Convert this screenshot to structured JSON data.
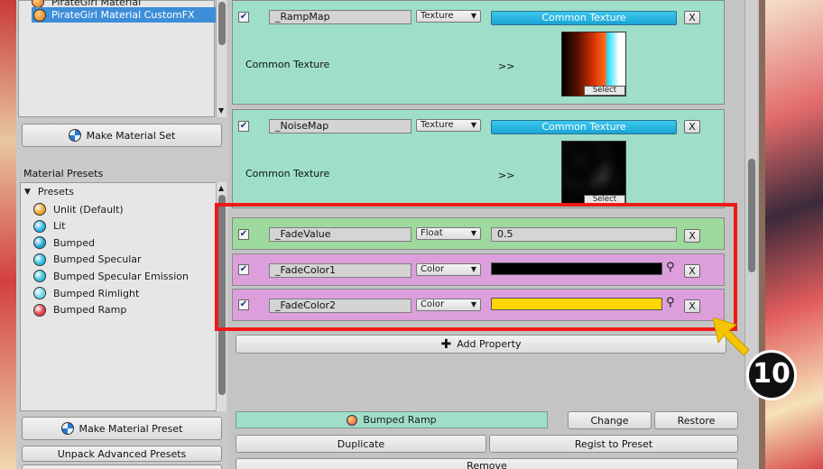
{
  "left_panel": {
    "material_list": [
      {
        "label": "PirateGirl Material",
        "selected": false
      },
      {
        "label": "PirateGirl Material CustomFX",
        "selected": true
      }
    ],
    "make_material_set": "Make Material Set",
    "presets_section_title": "Material Presets",
    "presets_root": "Presets",
    "presets": [
      {
        "label": "Unlit (Default)",
        "color": "#f5a623"
      },
      {
        "label": "Lit",
        "color": "#29b6e8"
      },
      {
        "label": "Bumped",
        "color": "#1fa8d8"
      },
      {
        "label": "Bumped Specular",
        "color": "#2ec0e0"
      },
      {
        "label": "Bumped Specular Emission",
        "color": "#35c4d8"
      },
      {
        "label": "Bumped Rimlight",
        "color": "#6ad8e8"
      },
      {
        "label": "Bumped Ramp",
        "color": "#e84040"
      }
    ],
    "make_material_preset": "Make Material Preset",
    "unpack_advanced_presets": "Unpack Advanced Presets"
  },
  "properties": [
    {
      "name": "_RampMap",
      "type": "Texture",
      "value": "Common Texture",
      "sub_label": "Common Texture",
      "arrow": ">>",
      "select": "Select",
      "enabled": true
    },
    {
      "name": "_NoiseMap",
      "type": "Texture",
      "value": "Common Texture",
      "sub_label": "Common Texture",
      "arrow": ">>",
      "select": "Select",
      "enabled": true
    },
    {
      "name": "_FadeValue",
      "type": "Float",
      "value": "0.5",
      "enabled": true
    },
    {
      "name": "_FadeColor1",
      "type": "Color",
      "color_value": "#000000",
      "enabled": true
    },
    {
      "name": "_FadeColor2",
      "type": "Color",
      "color_value": "#ffd400",
      "enabled": true
    }
  ],
  "remove_symbol": "X",
  "add_property": "Add Property",
  "bottom": {
    "current_preset": "Bumped Ramp",
    "change": "Change",
    "restore": "Restore",
    "duplicate": "Duplicate",
    "regist_to_preset": "Regist to Preset",
    "remove": "Remove"
  },
  "step_badge": "10",
  "colors": {
    "highlight_box": "#f01818",
    "arrow": "#f5c400",
    "texture_row": "#9fdfc9",
    "float_row": "#9ed99e",
    "color_row": "#dc9fdc"
  }
}
